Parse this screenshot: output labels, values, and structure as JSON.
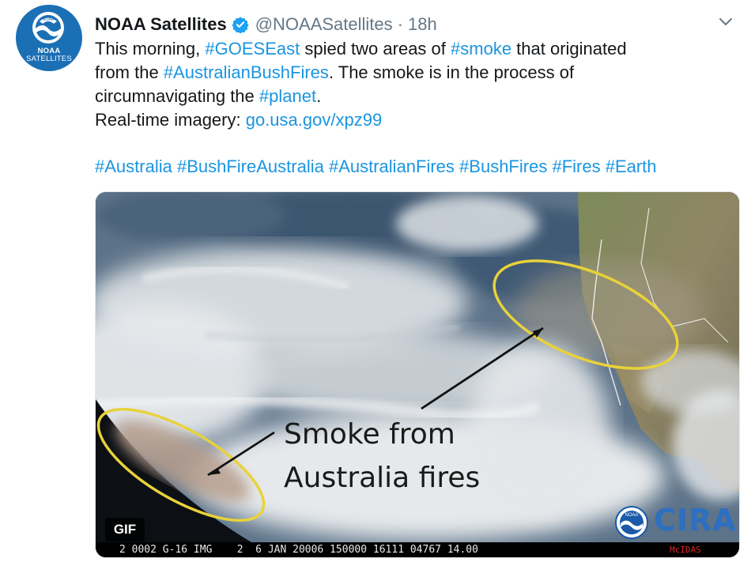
{
  "account": {
    "display_name": "NOAA Satellites",
    "handle": "@NOAASatellites",
    "separator": "·",
    "time": "18h",
    "avatar_line1": "NOAA",
    "avatar_line2": "SATELLITES",
    "avatar_seal_text": "NOAA"
  },
  "tweet": {
    "line1": {
      "p1": "This morning, ",
      "tag1": "#GOESEast",
      "p2": " spied two areas of ",
      "tag2": "#smoke",
      "p3": " that originated"
    },
    "line2": {
      "p1": "from the ",
      "tag1": "#AustralianBushFires",
      "p2": ". The smoke is in the process of"
    },
    "line3": {
      "p1": "circumnavigating the ",
      "tag1": "#planet",
      "p2": "."
    },
    "line4": {
      "p1": "Real-time imagery: ",
      "link": "go.usa.gov/xpz99"
    },
    "hashtags": [
      "#Australia",
      "#BushFireAustralia",
      "#AustralianFires",
      "#BushFires",
      "#Fires",
      "#Earth"
    ]
  },
  "media": {
    "badge": "GIF",
    "annotation_line1": "Smoke from",
    "annotation_line2": "Australia fires",
    "status_bar": "2 0002 G-16 IMG    2  6 JAN 20006 150000 16111 04767 14.00",
    "status_bar_right": "McIDAS",
    "logo_text": "CIRA",
    "logo_seal_text": "NOAA"
  },
  "colors": {
    "link": "#1b95e0",
    "verified": "#1da1f2",
    "avatar_bg": "#1b6fb5",
    "ellipse": "#e8d23a"
  },
  "icons": {
    "verified": "verified-badge-icon",
    "caret": "chevron-down-icon"
  }
}
